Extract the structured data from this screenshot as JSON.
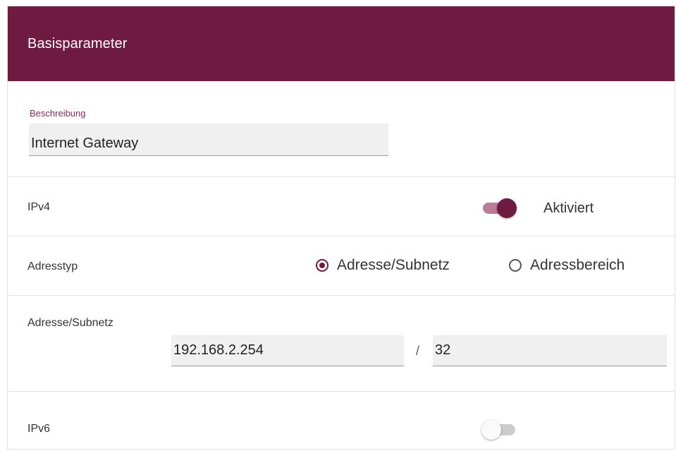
{
  "header": {
    "title": "Basisparameter"
  },
  "beschreibung": {
    "label": "Beschreibung",
    "value": "Internet Gateway"
  },
  "ipv4": {
    "label": "IPv4",
    "state_text": "Aktiviert",
    "enabled": true
  },
  "adresstyp": {
    "label": "Adresstyp",
    "options": [
      {
        "label": "Adresse/Subnetz",
        "selected": true
      },
      {
        "label": "Adressbereich",
        "selected": false
      }
    ]
  },
  "adresse_subnetz": {
    "label": "Adresse/Subnetz",
    "address": "192.168.2.254",
    "separator": "/",
    "prefix": "32"
  },
  "ipv6": {
    "label": "IPv6",
    "enabled": false
  },
  "colors": {
    "brand": "#6e1a41",
    "toggle_track_on": "#b87e98",
    "toggle_track_off": "#cccccc"
  }
}
